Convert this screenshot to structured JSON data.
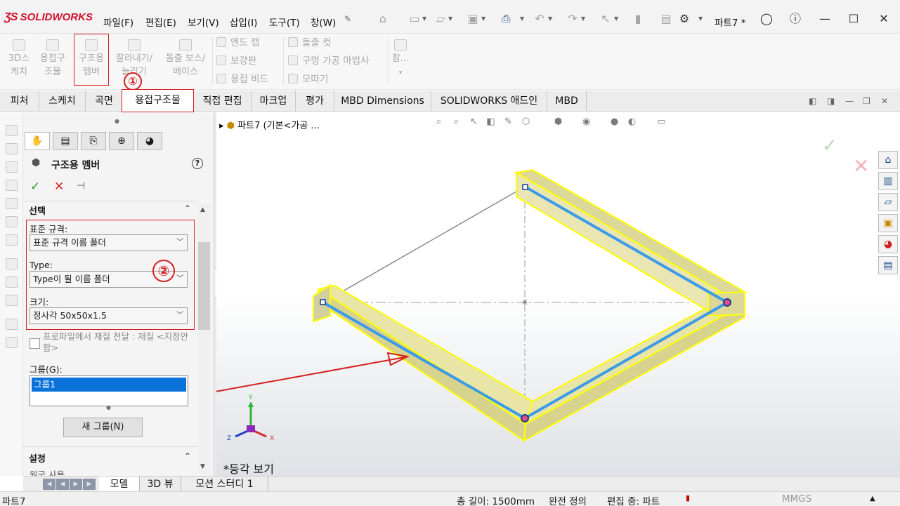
{
  "app": {
    "logo_text": "SOLIDWORKS",
    "document_title": "파트7 *"
  },
  "menu": [
    "파일(F)",
    "편집(E)",
    "보기(V)",
    "삽입(I)",
    "도구(T)",
    "창(W)"
  ],
  "command_manager": {
    "big_buttons": [
      {
        "label1": "3D스",
        "label2": "케치"
      },
      {
        "label1": "용접구",
        "label2": "조물"
      },
      {
        "label1": "구조용",
        "label2": "멤버"
      },
      {
        "label1": "잘라내기/",
        "label2": "늘리기"
      },
      {
        "label1": "돌출 보스/",
        "label2": "베이스"
      }
    ],
    "small_col1": [
      "엔드 캡",
      "보강판",
      "용접 비드"
    ],
    "small_col2": [
      "돌출 컷",
      "구멍 가공 마법사",
      "모따기"
    ],
    "ref_label": "참...",
    "annotation1": "①",
    "annotation2": "②"
  },
  "tabs": [
    "피처",
    "스케치",
    "곡면",
    "용접구조물",
    "직접 편집",
    "마크업",
    "평가",
    "MBD Dimensions",
    "SOLIDWORKS 애드인",
    "MBD"
  ],
  "property_manager": {
    "title": "구조용 멤버",
    "selection_header": "선택",
    "standard_label": "표준 규격:",
    "standard_value": "표준 규격 이름 폴더",
    "type_label": "Type:",
    "type_value": "Type이 될 이름 폴더",
    "size_label": "크기:",
    "size_value": "정사각 50x50x1.5",
    "transfer_text": "프로파일에서 재질 전달 : 재질 <지정안함>",
    "group_label": "그룹(G):",
    "group_items": [
      "그룹1"
    ],
    "new_group_button": "새 그룹(N)",
    "settings_header": "설정",
    "cut_off_text": "원국 사용"
  },
  "viewport": {
    "tree_text": "파트7  (기본<가공 ...",
    "view_name": "*등각 보기",
    "triad": {
      "x": "X",
      "y": "Y",
      "z": "Z"
    }
  },
  "bottom_tabs": [
    "모델",
    "3D 뷰",
    "모션 스터디 1"
  ],
  "status": {
    "left": "파트7",
    "total_length": "총 길이: 1500mm",
    "definition": "완전 정의",
    "editing": "편집 중: 파트",
    "units": "MMGS"
  },
  "colors": {
    "accent_red": "#d62020",
    "selection_blue": "#0b72d9",
    "member_yellow": "#ffff00",
    "path_blue": "#3c9be8"
  }
}
